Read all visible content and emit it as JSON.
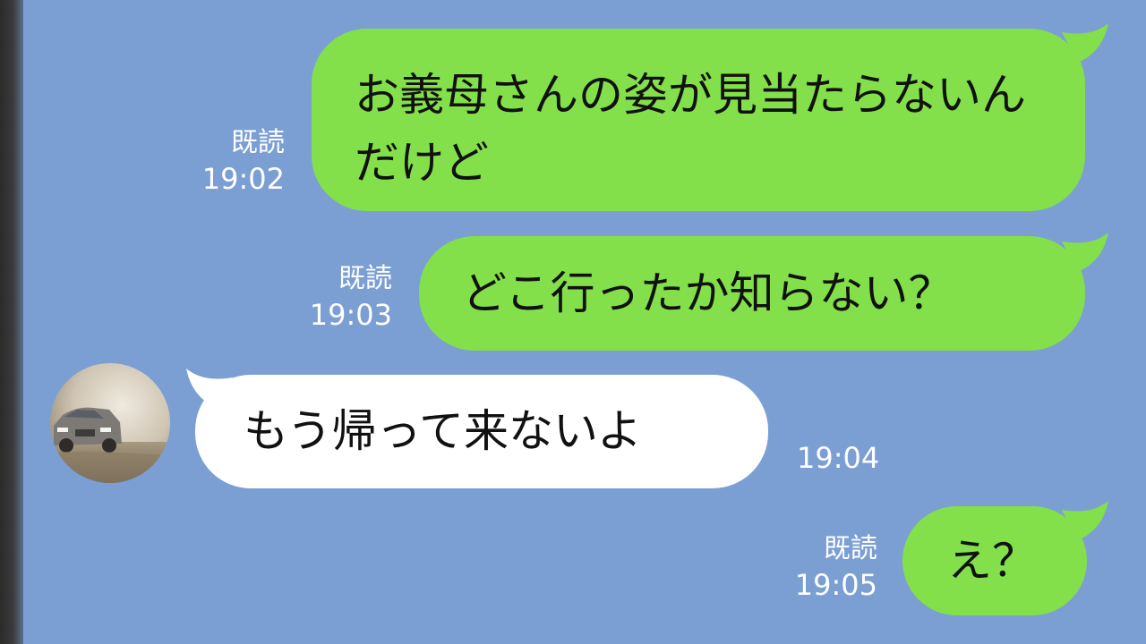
{
  "chat": {
    "messages": [
      {
        "sender": "self",
        "text": "お義母さんの姿が見当たらないんだけど",
        "read_label": "既読",
        "time": "19:02"
      },
      {
        "sender": "self",
        "text": "どこ行ったか知らない？",
        "read_label": "既読",
        "time": "19:03"
      },
      {
        "sender": "other",
        "text": "もう帰って来ないよ",
        "time": "19:04"
      },
      {
        "sender": "self",
        "text": "え？",
        "read_label": "既読",
        "time": "19:05"
      }
    ]
  },
  "colors": {
    "background": "#7b9fd3",
    "outgoing_bubble": "#84e04a",
    "incoming_bubble": "#ffffff",
    "meta_text": "#ffffff"
  },
  "icons": {
    "avatar": "contact-avatar-car-photo"
  }
}
